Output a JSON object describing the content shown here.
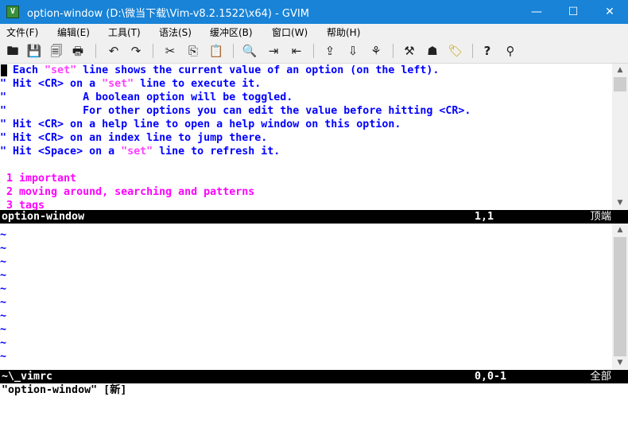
{
  "window": {
    "title": "option-window (D:\\微当下载\\Vim-v8.2.1522\\x64) - GVIM",
    "app_icon": "Vim",
    "controls": {
      "minimize": "—",
      "maximize": "☐",
      "close": "✕"
    }
  },
  "menu": {
    "items": [
      "文件(F)",
      "编辑(E)",
      "工具(T)",
      "语法(S)",
      "缓冲区(B)",
      "窗口(W)",
      "帮助(H)"
    ]
  },
  "toolbar": {
    "icons": [
      {
        "name": "open-icon",
        "glyph": "🖿"
      },
      {
        "name": "save-icon",
        "glyph": "💾"
      },
      {
        "name": "save-all-icon",
        "glyph": "🗐"
      },
      {
        "name": "print-icon",
        "glyph": "🖶"
      },
      {
        "name": "undo-icon",
        "glyph": "↶"
      },
      {
        "name": "redo-icon",
        "glyph": "↷"
      },
      {
        "name": "cut-icon",
        "glyph": "✂"
      },
      {
        "name": "copy-icon",
        "glyph": "⎘"
      },
      {
        "name": "paste-icon",
        "glyph": "📋"
      },
      {
        "name": "find-replace-icon",
        "glyph": "🔍"
      },
      {
        "name": "find-next-icon",
        "glyph": "⇥"
      },
      {
        "name": "find-prev-icon",
        "glyph": "⇤"
      },
      {
        "name": "load-session-icon",
        "glyph": "⇪"
      },
      {
        "name": "save-session-icon",
        "glyph": "⇩"
      },
      {
        "name": "run-script-icon",
        "glyph": "⚘"
      },
      {
        "name": "make-icon",
        "glyph": "⚒"
      },
      {
        "name": "run-ctags-icon",
        "glyph": "☗"
      },
      {
        "name": "jump-tag-icon",
        "glyph": "🏷"
      },
      {
        "name": "help-icon",
        "glyph": "?"
      },
      {
        "name": "find-help-icon",
        "glyph": "⚲"
      }
    ]
  },
  "upper_window": {
    "lines": [
      [
        {
          "t": "\" Each ",
          "c": "c"
        },
        {
          "t": "\"set\"",
          "c": "s"
        },
        {
          "t": " line shows the current value of an option (on the left).",
          "c": "c"
        }
      ],
      [
        {
          "t": "\" Hit <CR> on a ",
          "c": "c"
        },
        {
          "t": "\"set\"",
          "c": "s"
        },
        {
          "t": " line to execute it.",
          "c": "c"
        }
      ],
      [
        {
          "t": "\"            A boolean option will be toggled.",
          "c": "c"
        }
      ],
      [
        {
          "t": "\"            For other options you can edit the value before hitting <CR>.",
          "c": "c"
        }
      ],
      [
        {
          "t": "\" Hit <CR> on a help line to open a help window on this option.",
          "c": "c"
        }
      ],
      [
        {
          "t": "\" Hit <CR> on an index line to jump there.",
          "c": "c"
        }
      ],
      [
        {
          "t": "\" Hit <Space> on a ",
          "c": "c"
        },
        {
          "t": "\"set\"",
          "c": "s"
        },
        {
          "t": " line to refresh it.",
          "c": "c"
        }
      ],
      [
        {
          "t": "",
          "c": "c"
        }
      ],
      [
        {
          "t": " 1 important",
          "c": "h"
        }
      ],
      [
        {
          "t": " 2 moving around, searching and patterns",
          "c": "h"
        }
      ],
      [
        {
          "t": " 3 tags",
          "c": "h"
        }
      ]
    ],
    "status": {
      "name": "option-window",
      "position": "1,1",
      "scroll": "顶端"
    }
  },
  "lower_window": {
    "tilde_char": "~",
    "tilde_count": 10,
    "status": {
      "name": "~\\_vimrc",
      "position": "0,0-1",
      "scroll": "全部"
    }
  },
  "cmdline": {
    "text": "\"option-window\" [新]"
  },
  "scrollbar": {
    "up_arrow": "▲",
    "down_arrow": "▼"
  },
  "colors": {
    "titlebar": "#1883d7",
    "comment": "#0000ff",
    "string": "#ff40ff",
    "heading": "#ff00ff",
    "statusline_bg": "#000000",
    "statusline_fg": "#ffffff"
  }
}
